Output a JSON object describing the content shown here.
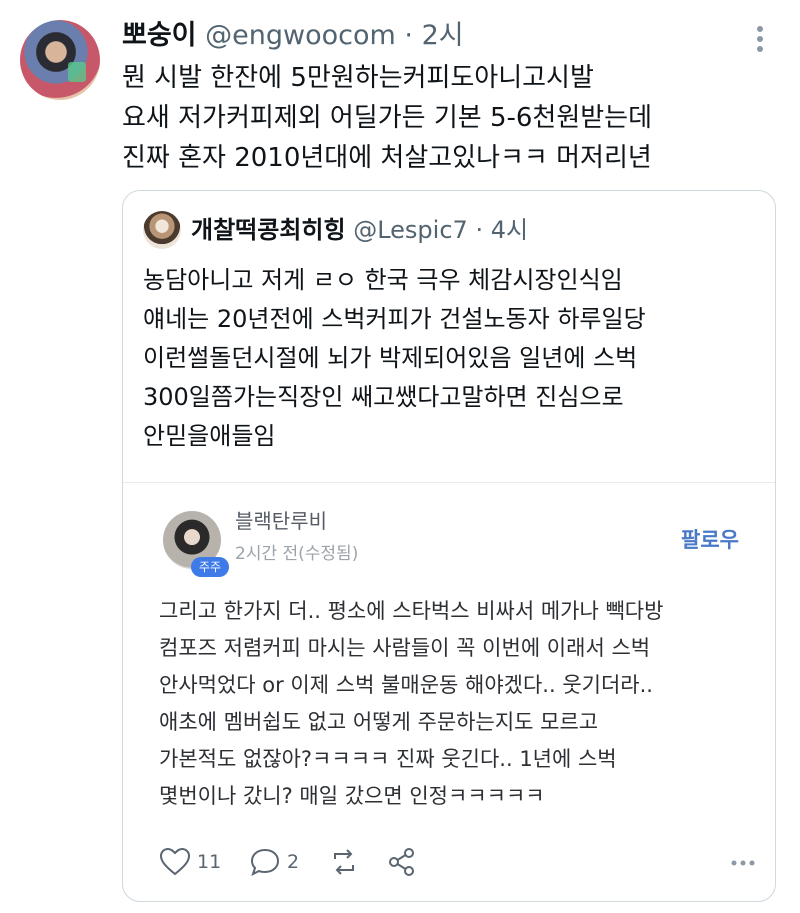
{
  "tweet": {
    "display_name": "뽀숭이",
    "handle": "@engwoocom",
    "separator": "·",
    "time": "2시",
    "lines": [
      "뭔 시발 한잔에 5만원하는커피도아니고시발",
      "요새 저가커피제외 어딜가든 기본 5-6천원받는데",
      "진짜 혼자 2010년대에 처살고있나ㅋㅋ 머저리년"
    ],
    "more_icon": "more-vertical-icon"
  },
  "quote": {
    "display_name": "개찰떡콩최히힝",
    "handle": "@Lespic7",
    "separator": "·",
    "time": "4시",
    "lines": [
      "농담아니고 저게 ㄹㅇ 한국 극우 체감시장인식임",
      "얘네는 20년전에 스벅커피가 건설노동자 하루일당",
      "이런썰돌던시절에 뇌가 박제되어있음 일년에 스벅",
      "300일쯤가는직장인 쌔고쌨다고말하면 진심으로",
      "안믿을애들임"
    ]
  },
  "inner_post": {
    "author": "블랙탄루비",
    "badge": "주주",
    "time": "2시간 전(수정됨)",
    "follow_label": "팔로우",
    "lines": [
      "그리고 한가지 더.. 평소에 스타벅스 비싸서 메가나 빽다방",
      "컴포즈 저렴커피 마시는 사람들이 꼭 이번에 이래서 스벅",
      "안사먹었다 or 이제 스벅 불매운동 해야겠다.. 웃기더라..",
      "애초에 멤버쉽도 없고 어떻게 주문하는지도 모르고",
      "가본적도 없잖아?ㅋㅋㅋㅋ 진짜 웃긴다.. 1년에 스벅",
      "몇번이나 갔니? 매일 갔으면 인정ㅋㅋㅋㅋㅋ"
    ],
    "actions": {
      "like_count": "11",
      "comment_count": "2",
      "like_icon": "heart-icon",
      "comment_icon": "comment-bubble-icon",
      "share_icon": "share-icon",
      "repost_icon": "repost-icon",
      "more_icon": "more-horizontal-icon"
    }
  }
}
